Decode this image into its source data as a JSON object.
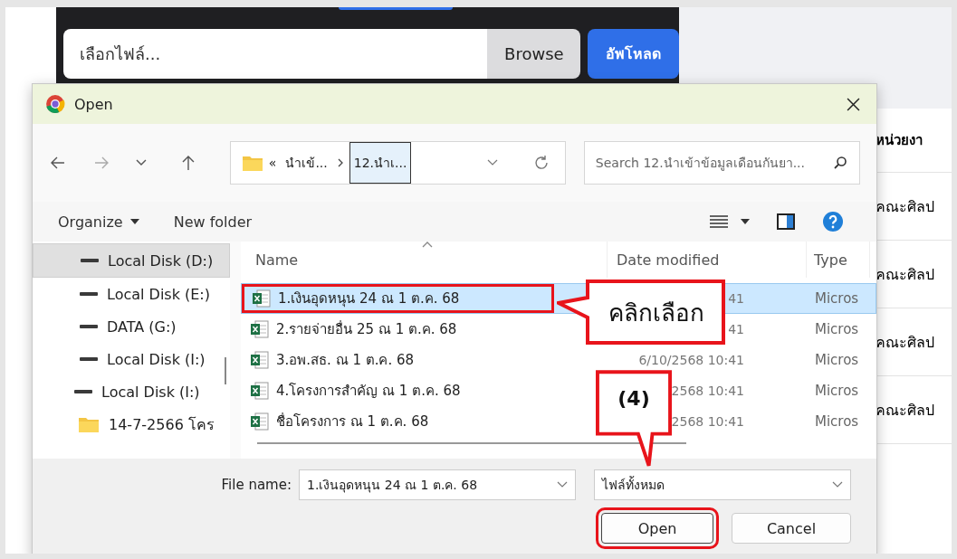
{
  "backdrop": {
    "file_input": {
      "placeholder": "เลือกไฟล์...",
      "browse": "Browse"
    },
    "upload_button": "อัพโหลด",
    "table": {
      "column": "หน่วยงา",
      "rows": [
        "คณะศิลป",
        "คณะศิลป",
        "คณะศิลป",
        "คณะศิลป"
      ]
    }
  },
  "dialog": {
    "title": "Open",
    "address": {
      "overflow": "«",
      "crumbs": [
        {
          "label": "นำเข้...",
          "selected": false
        },
        {
          "label": "12.นำเ...",
          "selected": true
        }
      ]
    },
    "search": {
      "placeholder": "Search 12.นำเข้าข้อมูลเดือนกันยา..."
    },
    "commands": [
      {
        "label": "Organize",
        "kind": "menu"
      },
      {
        "label": "New folder",
        "kind": "plain"
      }
    ],
    "nav": [
      {
        "label": "Local Disk (D:)",
        "kind": "drive",
        "selected": true
      },
      {
        "label": "Local Disk (E:)",
        "kind": "drive",
        "selected": false
      },
      {
        "label": "DATA (G:)",
        "kind": "drive",
        "selected": false
      },
      {
        "label": "Local Disk (I:)",
        "kind": "drive",
        "selected": false
      },
      {
        "label": "Local Disk (I:)",
        "kind": "drive",
        "selected": false,
        "children": [
          {
            "label": "14-7-2566 โคร",
            "kind": "folder",
            "selected": false
          }
        ]
      }
    ],
    "columns": [
      "Name",
      "Date modified",
      "Type"
    ],
    "files": [
      {
        "name": "1.เงินอุดหนุน 24 ณ 1 ต.ค. 68",
        "date": "41",
        "type": "Micros",
        "selected": true
      },
      {
        "name": "2.รายจ่ายอื่น 25 ณ 1 ต.ค. 68",
        "date": "41",
        "type": "Micros",
        "selected": false
      },
      {
        "name": "3.อพ.สธ. ณ 1 ต.ค. 68",
        "date": "6/10/2568 10:41",
        "type": "Micros",
        "selected": false
      },
      {
        "name": "4.โครงการสำคัญ ณ 1 ต.ค. 68",
        "date": "2568 10:41",
        "type": "Micros",
        "selected": false
      },
      {
        "name": "ชื่อโครงการ ณ 1 ต.ค. 68",
        "date": "2568 10:41",
        "type": "Micros",
        "selected": false
      }
    ],
    "file_name_label": "File name:",
    "file_name": "1.เงินอุดหนุน 24 ณ 1 ต.ค. 68",
    "filter": "ไฟล์ทั้งหมด",
    "buttons": [
      {
        "label": "Open",
        "kind": "primary"
      },
      {
        "label": "Cancel",
        "kind": "secondary"
      }
    ]
  },
  "annotations": [
    {
      "kind": "callout-left",
      "text": "คลิกเลือก"
    },
    {
      "kind": "callout-down",
      "text": "(4)"
    }
  ]
}
